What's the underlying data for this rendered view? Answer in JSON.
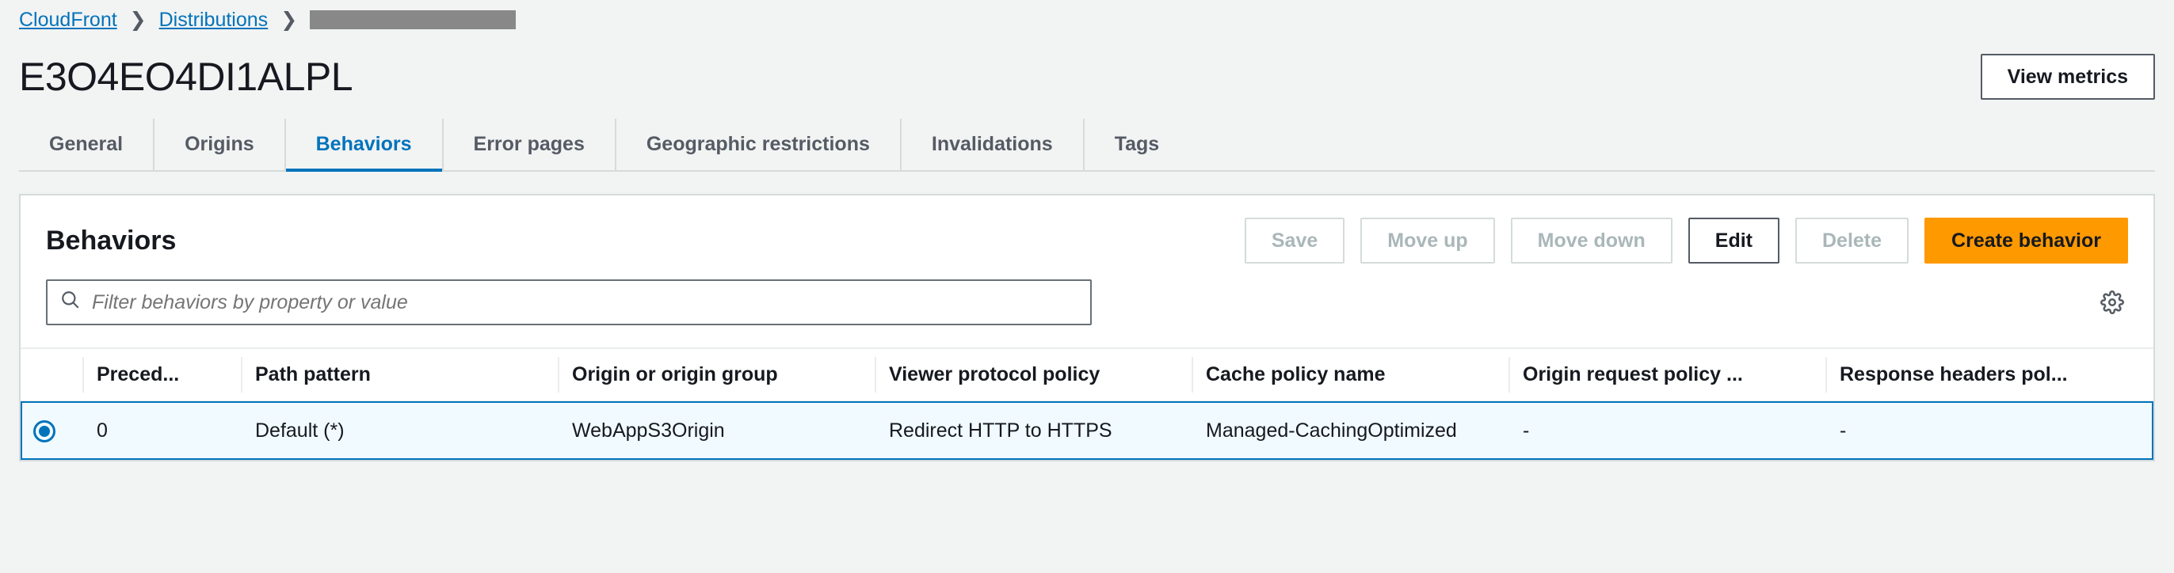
{
  "breadcrumb": {
    "items": [
      "CloudFront",
      "Distributions"
    ]
  },
  "page_title": "E3O4EO4DI1ALPL",
  "header_actions": {
    "view_metrics": "View metrics"
  },
  "tabs": [
    {
      "label": "General",
      "active": false
    },
    {
      "label": "Origins",
      "active": false
    },
    {
      "label": "Behaviors",
      "active": true
    },
    {
      "label": "Error pages",
      "active": false
    },
    {
      "label": "Geographic restrictions",
      "active": false
    },
    {
      "label": "Invalidations",
      "active": false
    },
    {
      "label": "Tags",
      "active": false
    }
  ],
  "panel": {
    "title": "Behaviors",
    "actions": {
      "save": "Save",
      "move_up": "Move up",
      "move_down": "Move down",
      "edit": "Edit",
      "delete": "Delete",
      "create": "Create behavior"
    },
    "filter_placeholder": "Filter behaviors by property or value"
  },
  "table": {
    "columns": {
      "precedence": "Preced...",
      "path_pattern": "Path pattern",
      "origin": "Origin or origin group",
      "viewer_policy": "Viewer protocol policy",
      "cache_policy": "Cache policy name",
      "origin_request_policy": "Origin request policy ...",
      "response_headers_policy": "Response headers pol..."
    },
    "rows": [
      {
        "selected": true,
        "precedence": "0",
        "path_pattern": "Default (*)",
        "origin": "WebAppS3Origin",
        "viewer_policy": "Redirect HTTP to HTTPS",
        "cache_policy": "Managed-CachingOptimized",
        "origin_request_policy": "-",
        "response_headers_policy": "-"
      }
    ]
  }
}
